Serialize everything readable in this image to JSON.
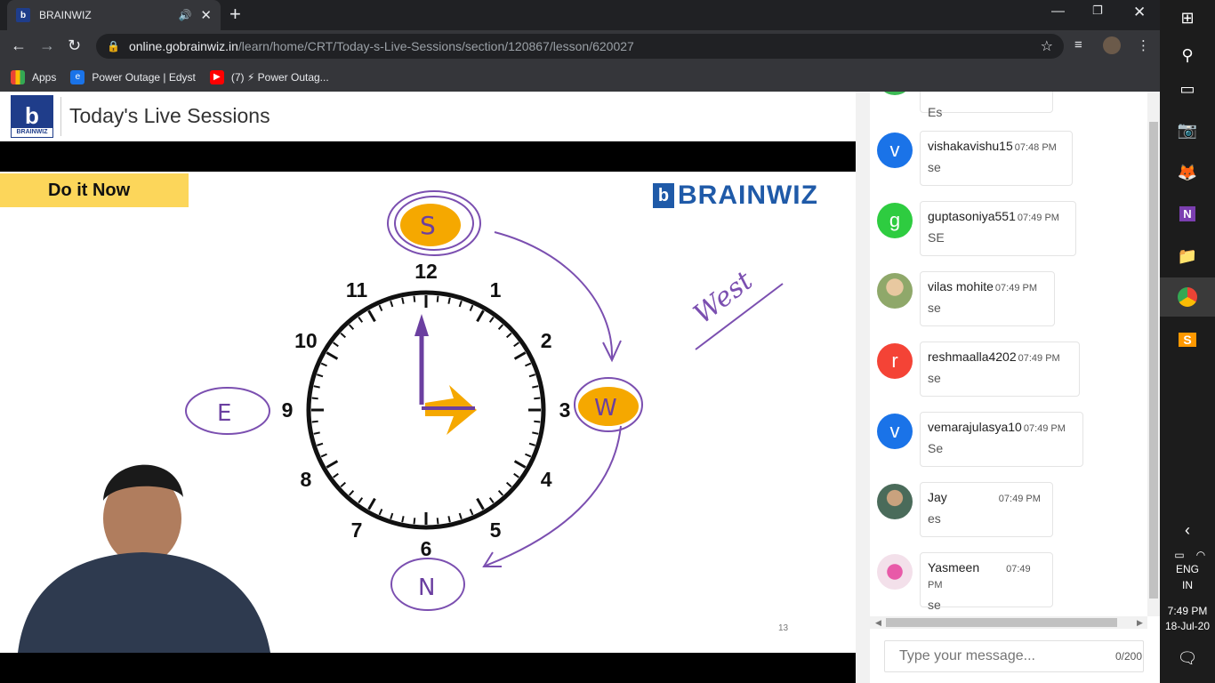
{
  "browser": {
    "tab_title": "BRAINWIZ",
    "favicon_letter": "b",
    "url_host": "online.gobrainwiz.in",
    "url_path": "/learn/home/CRT/Today-s-Live-Sessions/section/120867/lesson/620027"
  },
  "bookmarks": [
    {
      "label": "Apps"
    },
    {
      "label": "Power Outage | Edyst"
    },
    {
      "label": "(7) ⚡ Power Outag..."
    }
  ],
  "header": {
    "logo_letter": "b",
    "logo_word": "BRAINWIZ",
    "title": "Today's Live Sessions"
  },
  "slide": {
    "badge": "Do it Now",
    "brand": "BRAINWIZ",
    "brand_letter": "b",
    "slide_number": "13",
    "clock_numbers": [
      "12",
      "1",
      "2",
      "3",
      "4",
      "5",
      "6",
      "7",
      "8",
      "9",
      "10",
      "11"
    ],
    "annotations": {
      "south": "S",
      "west_circle": "W",
      "east": "E",
      "north": "N",
      "west_word": "West"
    }
  },
  "chat": {
    "messages": [
      {
        "initial": "",
        "name": "",
        "time": "",
        "text": "Es",
        "color": "#3cba54"
      },
      {
        "initial": "v",
        "name": "vishakavishu15",
        "time": "07:48 PM",
        "text": "se",
        "color": "#1a73e8"
      },
      {
        "initial": "g",
        "name": "guptasoniya551",
        "time": "07:49 PM",
        "text": "SE",
        "color": "#2ecc40"
      },
      {
        "initial": "",
        "name": "vilas mohite",
        "time": "07:49 PM",
        "text": "se",
        "color": "#8fa86a"
      },
      {
        "initial": "r",
        "name": "reshmaalla4202",
        "time": "07:49 PM",
        "text": "se",
        "color": "#f44336"
      },
      {
        "initial": "v",
        "name": "vemarajulasya10",
        "time": "07:49 PM",
        "text": "Se",
        "color": "#1a73e8"
      },
      {
        "initial": "",
        "name": "Jay",
        "time": "07:49 PM",
        "text": "es",
        "color": "#4a6b5a"
      },
      {
        "initial": "",
        "name": "Yasmeen",
        "time": "07:49 PM",
        "text": "se",
        "color": "#f3b8d2"
      }
    ],
    "input_placeholder": "Type your message...",
    "char_count": "0/200"
  },
  "taskbar": {
    "lang": "ENG",
    "region": "IN",
    "time": "7:49 PM",
    "date": "18-Jul-20"
  }
}
